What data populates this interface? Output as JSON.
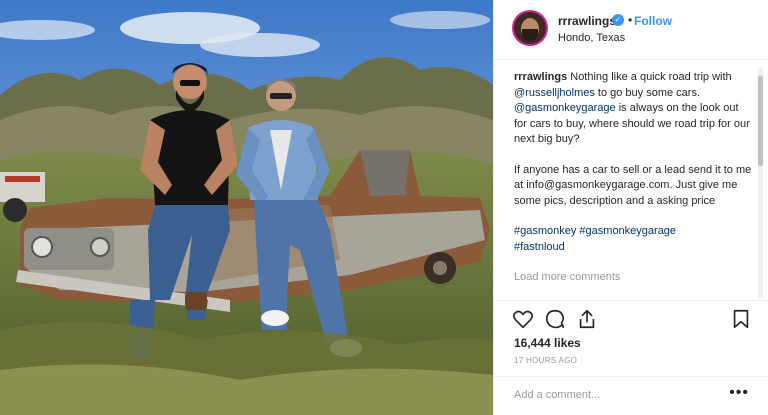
{
  "post": {
    "username": "rrrawlings",
    "follow_label": "Follow",
    "dot": "•",
    "verified_mark": "✓",
    "location": "Hondo, Texas",
    "photo_icon": "photo-of-two-men-on-old-car"
  },
  "caption": {
    "author": "rrrawlings",
    "line1_text": " Nothing like a quick road trip with ",
    "mention1": "@russelljholmes",
    "line1_tail": " to go buy some cars.",
    "mention2": "@gasmonkeygarage",
    "line2_tail": " is always on the look out for cars to buy, where should we road trip for our next big buy?",
    "para2": "If anyone has a car to sell or a lead send it to me at info@gasmonkeygarage.com. Just give me some pics, description and a asking price",
    "hashtags": "#gasmonkey #gasmonkeygarage",
    "hashtag3": "#fastnloud"
  },
  "comments": {
    "load_more": "Load more comments"
  },
  "actions": {
    "icons": [
      "heart-icon",
      "comment-icon",
      "share-icon",
      "bookmark-icon"
    ]
  },
  "stats": {
    "likes": "16,444 likes",
    "time": "17 HOURS AGO"
  },
  "comment_box": {
    "placeholder": "Add a comment...",
    "more_label": "•••"
  }
}
